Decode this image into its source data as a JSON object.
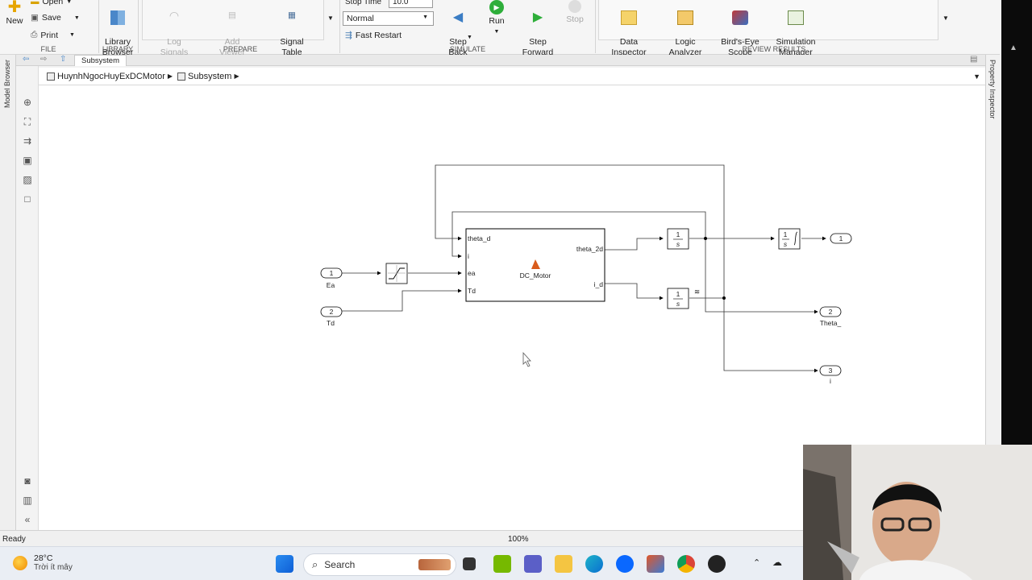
{
  "ribbon": {
    "file": {
      "section_label": "FILE",
      "new_label": "New",
      "open_label": "Open",
      "save_label": "Save",
      "print_label": "Print"
    },
    "library": {
      "section_label": "LIBRARY",
      "library_browser_label": "Library\nBrowser"
    },
    "prepare": {
      "section_label": "PREPARE",
      "log_signals_label": "Log\nSignals",
      "add_viewer_label": "Add\nViewer",
      "signal_table_label": "Signal\nTable"
    },
    "simulate": {
      "section_label": "SIMULATE",
      "stop_time_label": "Stop Time",
      "stop_time_value": "10.0",
      "mode_value": "Normal",
      "fast_restart_label": "Fast Restart",
      "step_back_label": "Step\nBack",
      "run_label": "Run",
      "step_forward_label": "Step\nForward",
      "stop_label": "Stop"
    },
    "review": {
      "section_label": "REVIEW RESULTS",
      "data_inspector_label": "Data\nInspector",
      "logic_analyzer_label": "Logic\nAnalyzer",
      "birds_eye_label": "Bird's-Eye\nScope",
      "sim_manager_label": "Simulation\nManager"
    }
  },
  "side_panels": {
    "model_browser": "Model Browser",
    "property_inspector": "Property Inspector"
  },
  "tab": {
    "label": "Subsystem"
  },
  "breadcrumb": {
    "items": [
      "HuynhNgocHuyExDCMotor",
      "Subsystem"
    ]
  },
  "diagram": {
    "inports": [
      {
        "number": "1",
        "name": "Ea"
      },
      {
        "number": "2",
        "name": "Td"
      }
    ],
    "outports": [
      {
        "number": "1",
        "name": ""
      },
      {
        "number": "2",
        "name": "Theta_"
      },
      {
        "number": "3",
        "name": "i"
      }
    ],
    "dc_motor": {
      "name": "DC_Motor",
      "in_ports": [
        "theta_d",
        "i",
        "ea",
        "Td"
      ],
      "out_ports": [
        "theta_2d",
        "i_d"
      ]
    },
    "integrator_label_num": "1",
    "integrator_label_den": "s"
  },
  "status": {
    "left": "Ready",
    "zoom": "100%"
  },
  "taskbar": {
    "temperature": "28°C",
    "weather": "Trời ít mây",
    "search_placeholder": "Search"
  }
}
